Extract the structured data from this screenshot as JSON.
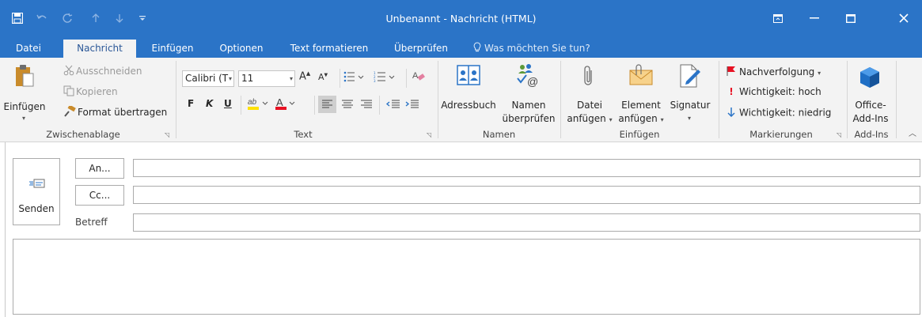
{
  "window": {
    "title": "Unbenannt - Nachricht (HTML)"
  },
  "tabs": [
    "Datei",
    "Nachricht",
    "Einfügen",
    "Optionen",
    "Text formatieren",
    "Überprüfen"
  ],
  "tell_me": "Was möchten Sie tun?",
  "ribbon": {
    "clipboard": {
      "label": "Zwischenablage",
      "paste": "Einfügen",
      "cut": "Ausschneiden",
      "copy": "Kopieren",
      "format_painter": "Format übertragen"
    },
    "text": {
      "label": "Text",
      "font": "Calibri (T",
      "size": "11",
      "bold": "F",
      "italic": "K",
      "underline": "U"
    },
    "names": {
      "label": "Namen",
      "address_book": "Adressbuch",
      "check_names_1": "Namen",
      "check_names_2": "überprüfen"
    },
    "insert": {
      "label": "Einfügen",
      "attach_file_1": "Datei",
      "attach_file_2": "anfügen",
      "attach_item_1": "Element",
      "attach_item_2": "anfügen",
      "signature": "Signatur"
    },
    "tags": {
      "label": "Markierungen",
      "follow_up": "Nachverfolgung",
      "high": "Wichtigkeit: hoch",
      "low": "Wichtigkeit: niedrig"
    },
    "addins": {
      "label": "Add-Ins",
      "office_1": "Office-",
      "office_2": "Add-Ins"
    }
  },
  "compose": {
    "send": "Senden",
    "to": "An...",
    "cc": "Cc...",
    "subject": "Betreff",
    "to_value": "",
    "cc_value": "",
    "subject_value": ""
  },
  "colors": {
    "accent": "#2b74c7",
    "ribbon_bg": "#f3f3f3",
    "high_importance": "#e81123",
    "low_importance": "#2b74c7"
  }
}
